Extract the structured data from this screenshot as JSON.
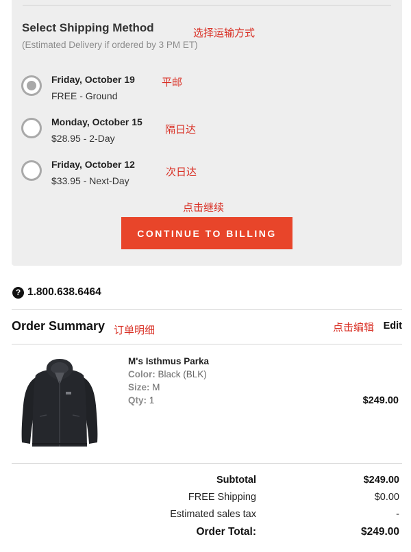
{
  "shipping": {
    "title": "Select Shipping Method",
    "subtitle": "(Estimated Delivery if ordered by 3 PM ET)",
    "annotation": "选择运输方式",
    "options": [
      {
        "date": "Friday, October 19",
        "price": "FREE - Ground",
        "selected": true,
        "annotation": "平邮"
      },
      {
        "date": "Monday, October 15",
        "price": "$28.95 - 2-Day",
        "selected": false,
        "annotation": "隔日达"
      },
      {
        "date": "Friday, October 12",
        "price": "$33.95 - Next-Day",
        "selected": false,
        "annotation": "次日达"
      }
    ],
    "continue_annotation": "点击继续",
    "continue_label": "CONTINUE TO BILLING",
    "accent_color": "#e8452a"
  },
  "phone": {
    "icon": "help-circle-icon",
    "number": "1.800.638.6464"
  },
  "summary": {
    "title": "Order Summary",
    "title_annotation": "订单明细",
    "edit_annotation": "点击编辑",
    "edit_label": "Edit",
    "product": {
      "name": "M's Isthmus Parka",
      "color_label": "Color:",
      "color_value": "Black (BLK)",
      "size_label": "Size:",
      "size_value": "M",
      "qty_label": "Qty:",
      "qty_value": "1",
      "price": "$249.00",
      "image": "black-hooded-parka-image"
    },
    "totals": {
      "subtotal_label": "Subtotal",
      "subtotal_value": "$249.00",
      "shipping_label": "FREE Shipping",
      "shipping_value": "$0.00",
      "tax_label": "Estimated sales tax",
      "tax_value": "-",
      "total_label": "Order Total:",
      "total_value": "$249.00"
    }
  }
}
